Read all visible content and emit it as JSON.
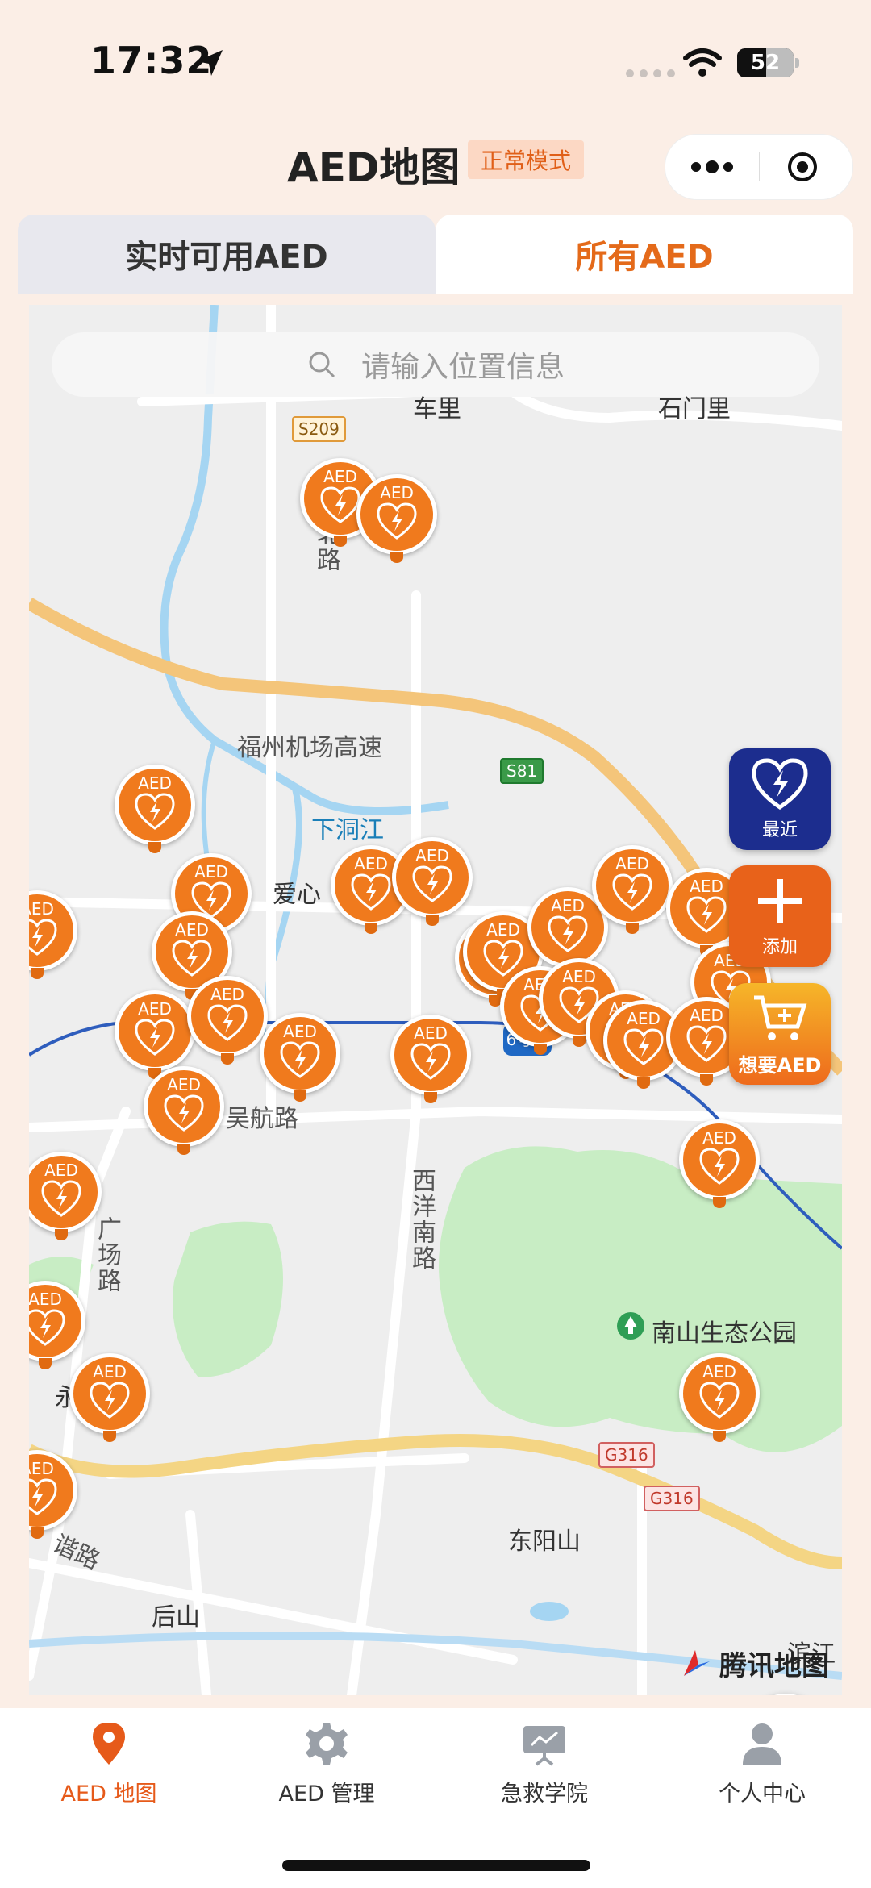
{
  "status_bar": {
    "time": "17:32",
    "battery": "52"
  },
  "nav": {
    "title": "AED地图",
    "mode": "正常模式"
  },
  "tabs": [
    {
      "label": "实时可用AED"
    },
    {
      "label": "所有AED"
    }
  ],
  "search": {
    "placeholder": "请输入位置信息"
  },
  "map_labels": {
    "cheli": "车里",
    "shimenli": "石门里",
    "beilu": "北路",
    "airport_hwy": "福州机场高速",
    "xiadongjiang": "下洞江",
    "aixin": "爱心",
    "wuhang": "吴航路",
    "xiyang": "西洋南路",
    "guangchang": "广场路",
    "nanshan": "南山生态公园",
    "yong": "永",
    "dongyangshan": "东阳山",
    "houshan": "后山",
    "xiehe": "谐路",
    "binjiang": "滨江",
    "metro": "6号线"
  },
  "road_shields": {
    "s209": "S209",
    "s81": "S81",
    "g316a": "G316",
    "g316b": "G316"
  },
  "pin_label": "AED",
  "side_buttons": {
    "near": "最近",
    "add": "添加",
    "want": "想要AED"
  },
  "map_logo": "腾讯地图",
  "tabbar": [
    {
      "label": "AED 地图",
      "icon": "map-pin-icon"
    },
    {
      "label": "AED 管理",
      "icon": "gear-icon"
    },
    {
      "label": "急救学院",
      "icon": "presentation-icon"
    },
    {
      "label": "个人中心",
      "icon": "person-icon"
    }
  ],
  "colors": {
    "accent": "#e65a1a",
    "pin": "#f07a1d",
    "near_button": "#1c2d8e"
  }
}
